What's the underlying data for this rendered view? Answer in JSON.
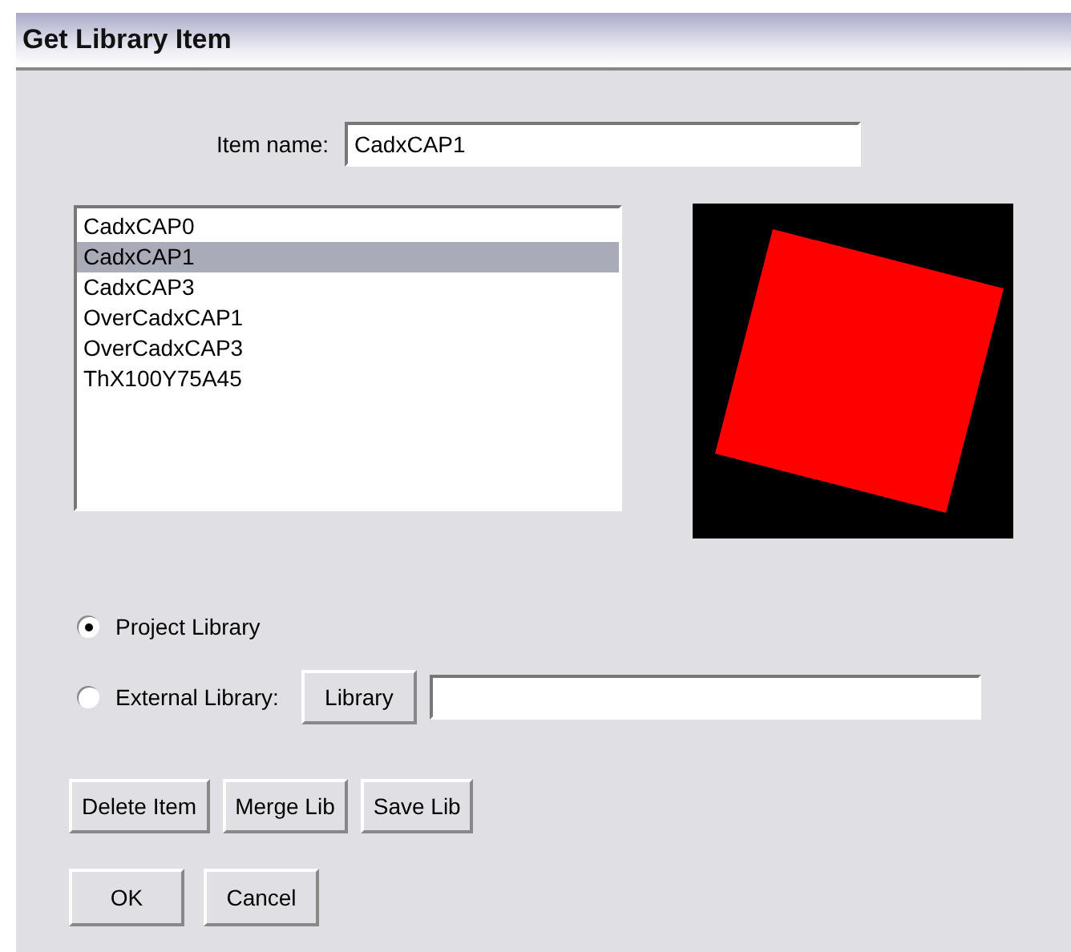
{
  "window": {
    "title": "Get Library Item"
  },
  "item_name": {
    "label": "Item name:",
    "value": "CadxCAP1"
  },
  "list": [
    {
      "label": "CadxCAP0",
      "selected": false
    },
    {
      "label": "CadxCAP1",
      "selected": true
    },
    {
      "label": "CadxCAP3",
      "selected": false
    },
    {
      "label": "OverCadxCAP1",
      "selected": false
    },
    {
      "label": "OverCadxCAP3",
      "selected": false
    },
    {
      "label": "ThX100Y75A45",
      "selected": false
    }
  ],
  "source": [
    {
      "label": "Project Library",
      "selected": true
    },
    {
      "label": "External Library:",
      "selected": false
    }
  ],
  "library_button": "Library",
  "action_buttons": [
    "Delete Item",
    "Merge Lib",
    "Save Lib"
  ],
  "dialog_buttons": [
    "OK",
    "Cancel"
  ]
}
